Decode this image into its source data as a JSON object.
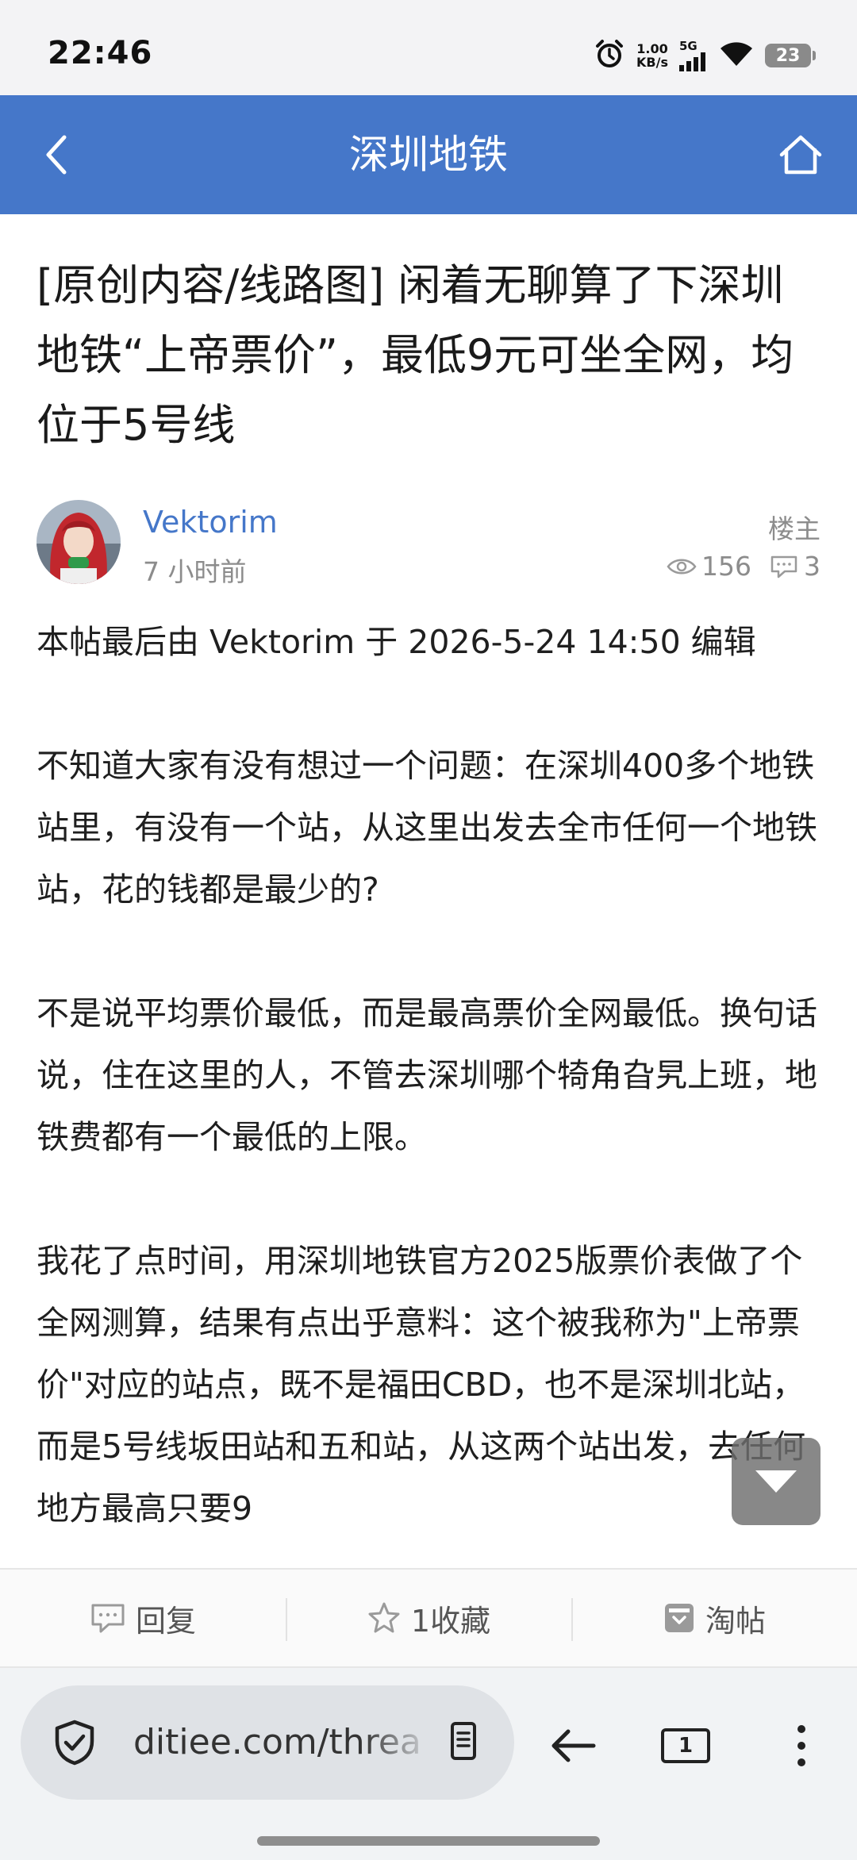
{
  "status_bar": {
    "time": "22:46",
    "net_speed_value": "1.00",
    "net_speed_unit": "KB/s",
    "network": "5G",
    "battery": "23",
    "icons": [
      "alarm-icon",
      "signal-icon",
      "wifi-icon",
      "battery-icon"
    ]
  },
  "header": {
    "title": "深圳地铁",
    "back_icon": "chevron-left-icon",
    "home_icon": "home-icon",
    "color": "#4577c9"
  },
  "post": {
    "title": "[原创内容/线路图] 闲着无聊算了下深圳地铁“上帝票价”，最低9元可坐全网，均位于5号线",
    "author": "Vektorim",
    "time": "7 小时前",
    "badge": "楼主",
    "views": "156",
    "replies": "3",
    "body": [
      "本帖最后由 Vektorim 于 2026-5-24 14:50 编辑",
      "不知道大家有没有想过一个问题：在深圳400多个地铁站里，有没有一个站，从这里出发去全市任何一个地铁站，花的钱都是最少的?",
      "不是说平均票价最低，而是最高票价全网最低。换句话说，住在这里的人，不管去深圳哪个犄角旮旯上班，地铁费都有一个最低的上限。",
      "我花了点时间，用深圳地铁官方2025版票价表做了个全网测算，结果有点出乎意料：这个被我称为\"上帝票价\"对应的站点，既不是福田CBD，也不是深圳北站，而是5号线坂田站和五和站，从这两个站出发，去任何地方最高只要9"
    ]
  },
  "actions": {
    "reply": "回复",
    "favorite": "1收藏",
    "tao": "淘帖"
  },
  "browser": {
    "url": "ditiee.com/thread",
    "tabs_count": "1"
  }
}
